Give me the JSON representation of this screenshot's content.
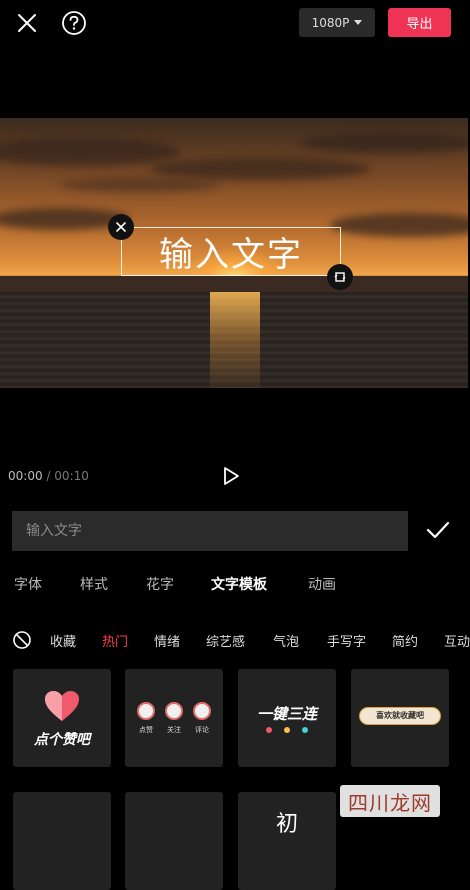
{
  "topbar": {
    "close_icon": "close-icon",
    "help_icon": "help-icon",
    "resolution": "1080P",
    "export_label": "导出",
    "accent_color": "#ee3355"
  },
  "preview": {
    "overlay_text": "输入文字"
  },
  "playback": {
    "current": "00:00",
    "separator": "/",
    "total": "00:10"
  },
  "text_input": {
    "placeholder": "输入文字",
    "confirm_icon": "check-icon"
  },
  "tabs": [
    "字体",
    "样式",
    "花字",
    "文字模板",
    "动画"
  ],
  "active_tab": "文字模板",
  "categories": [
    "收藏",
    "热门",
    "情绪",
    "综艺感",
    "气泡",
    "手写字",
    "简约",
    "互动"
  ],
  "active_category": "热门",
  "templates": [
    {
      "label": "点个赞吧"
    },
    {
      "labels": [
        "点赞",
        "关注",
        "评论"
      ]
    },
    {
      "label": "一键三连"
    },
    {
      "label": "喜欢就收藏吧"
    },
    {},
    {},
    {
      "label": "初"
    }
  ],
  "watermark": "四川龙网"
}
